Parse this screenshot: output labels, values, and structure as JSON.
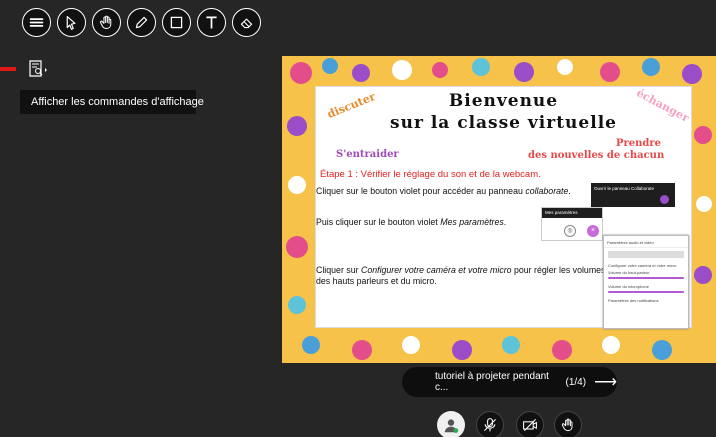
{
  "toolbar": {
    "items": [
      "menu-icon",
      "pointer-icon",
      "hand-icon",
      "pencil-icon",
      "rectangle-icon",
      "text-icon",
      "eraser-icon"
    ]
  },
  "view_controls": {
    "tooltip": "Afficher les commandes d'affichage"
  },
  "slide": {
    "title_line1": "Bienvenue",
    "title_line2": "sur la classe virtuelle",
    "word_discuter": "discuter",
    "word_echanger": "échanger",
    "word_entraider": "S'entraider",
    "word_prendre": "Prendre",
    "word_nouvelles": "des nouvelles de chacun",
    "etape": "Étape 1 : Vérifier le réglage du son et de la webcam.",
    "line1_pre": "Cliquer sur le bouton violet pour accéder au panneau ",
    "line1_em": "collaborate",
    "line1_post": ".",
    "line2_pre": "Puis cliquer sur le bouton violet ",
    "line2_em": "Mes paramètres",
    "line2_post": ".",
    "line3_pre": "Cliquer sur ",
    "line3_em": "Configurer votre caméra et votre micro",
    "line3_post": " pour régler les volumes des hauts parleurs et  du micro.",
    "mini_panel_label": "Ouvrir le panneau Collaborate",
    "mini_settings_label": "Mes paramètres",
    "mini_audio_header": "Paramètres audio et vidéo",
    "mini_config_btn": "Configurer votre caméra et votre micro",
    "mini_speaker_label": "Volume du haut-parleur",
    "mini_mic_label": "Volume du microphone",
    "mini_notifications": "Paramètres des notifications"
  },
  "navigation": {
    "title": "tutoriel à projeter pendant c...",
    "page_indicator": "(1/4)"
  },
  "colors": {
    "background": "#262626",
    "accent_purple": "#9a4dc7",
    "step_red": "#e02222",
    "slide_border": "#f7c24a"
  }
}
